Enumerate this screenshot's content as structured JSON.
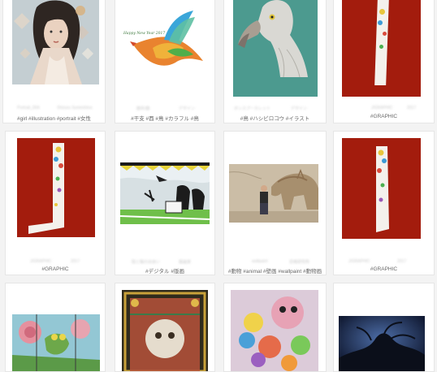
{
  "cards": [
    {
      "tags": "#girl #illustration #portrait #女性",
      "meta_left": "Portrait_00A",
      "meta_right": "Shizuru Sumeshina"
    },
    {
      "tags": "#干支 #酉 #鳥 #カラフル #鳥",
      "meta_left": "酉年/酉",
      "meta_right": "デザイン",
      "image_caption": "Happy New Year 2017"
    },
    {
      "tags": "#鳥 #ハシビロコウ #イラスト",
      "meta_left": "ボンスプーカレット",
      "meta_right": "デザイン"
    },
    {
      "tags": "#GRAPHIC",
      "meta_left": "J/GRAPHIC",
      "meta_right": "2017"
    },
    {
      "tags": "#GRAPHIC",
      "meta_left": "J/GRAPHIC",
      "meta_right": "2017"
    },
    {
      "tags": "#デジタル #版画",
      "meta_left": "陰と陽の出会い",
      "meta_right": "版画家"
    },
    {
      "tags": "#動物 #animal #壁画 #wallpaint #動物画",
      "meta_left": "wallpaint",
      "meta_right": "恐竜研究所"
    },
    {
      "tags": "#GRAPHIC",
      "meta_left": "J/GRAPHIC",
      "meta_right": "2017"
    },
    {
      "tags": "",
      "meta_left": "",
      "meta_right": ""
    },
    {
      "tags": "",
      "meta_left": "",
      "meta_right": ""
    },
    {
      "tags": "",
      "meta_left": "",
      "meta_right": ""
    },
    {
      "tags": "",
      "meta_left": "",
      "meta_right": ""
    }
  ]
}
